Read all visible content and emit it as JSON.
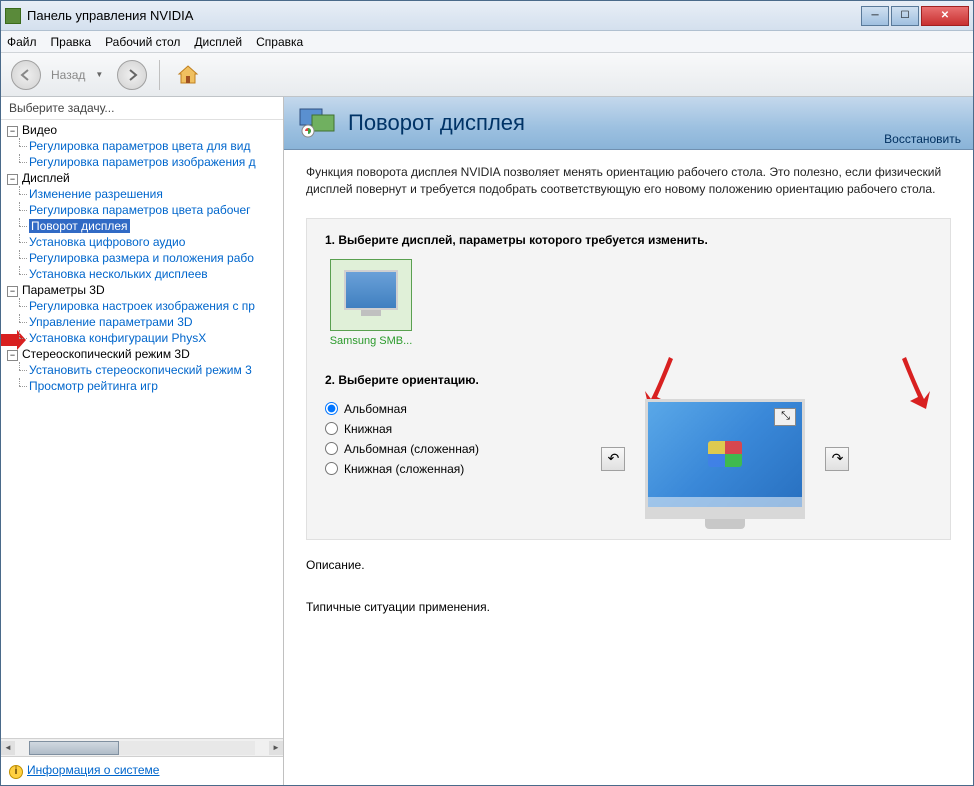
{
  "window": {
    "title": "Панель управления NVIDIA"
  },
  "menu": {
    "file": "Файл",
    "edit": "Правка",
    "desktop": "Рабочий стол",
    "display": "Дисплей",
    "help": "Справка"
  },
  "toolbar": {
    "back": "Назад"
  },
  "sidebar": {
    "header": "Выберите задачу...",
    "groups": [
      {
        "name": "Видео",
        "items": [
          "Регулировка параметров цвета для вид",
          "Регулировка параметров изображения д"
        ]
      },
      {
        "name": "Дисплей",
        "items": [
          "Изменение разрешения",
          "Регулировка параметров цвета рабочег",
          "Поворот дисплея",
          "Установка цифрового аудио",
          "Регулировка размера и положения рабо",
          "Установка нескольких дисплеев"
        ]
      },
      {
        "name": "Параметры 3D",
        "items": [
          "Регулировка настроек изображения с пр",
          "Управление параметрами 3D",
          "Установка конфигурации PhysX"
        ]
      },
      {
        "name": "Стереоскопический режим 3D",
        "items": [
          "Установить стереоскопический режим 3",
          "Просмотр рейтинга игр"
        ]
      }
    ],
    "selected": "Поворот дисплея",
    "sysinfo": "Информация о системе"
  },
  "page": {
    "title": "Поворот дисплея",
    "restore": "Восстановить",
    "intro": "Функция поворота дисплея NVIDIA позволяет менять ориентацию рабочего стола. Это полезно, если физический дисплей повернут и требуется подобрать соответствующую его новому положению ориентацию рабочего стола.",
    "step1_title": "1. Выберите дисплей, параметры которого требуется изменить.",
    "display_name": "Samsung SMB...",
    "step2_title": "2. Выберите ориентацию.",
    "orientations": [
      "Альбомная",
      "Книжная",
      "Альбомная (сложенная)",
      "Книжная (сложенная)"
    ],
    "orientation_selected": 0,
    "desc_label": "Описание.",
    "usecases_label": "Типичные ситуации применения."
  }
}
